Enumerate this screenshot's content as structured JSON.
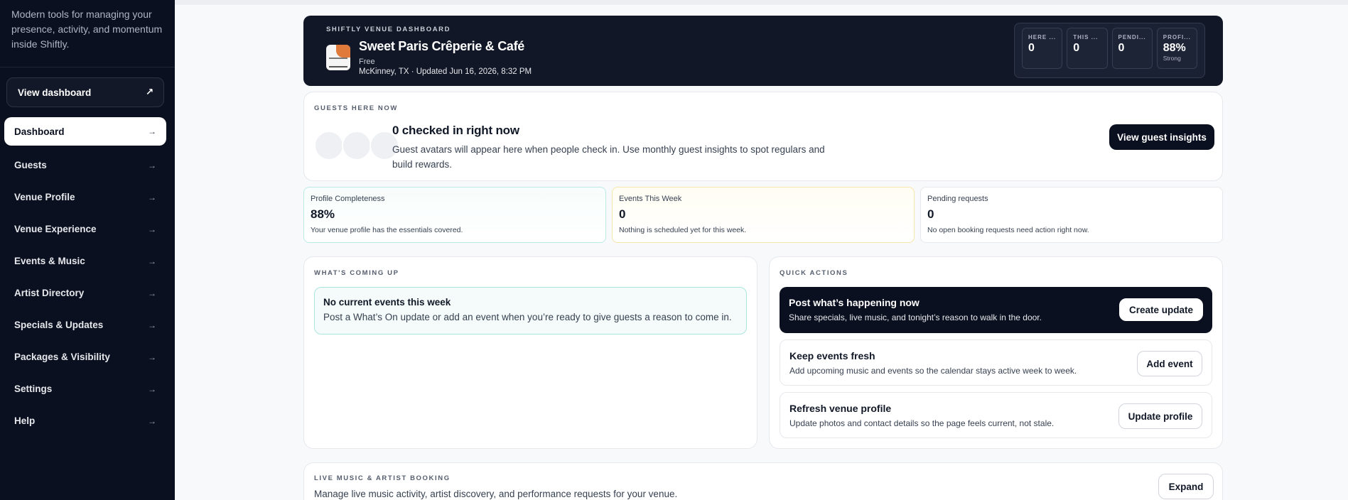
{
  "sidebar": {
    "tagline": "Modern tools for managing your presence, activity, and momentum inside Shiftly.",
    "view_dashboard": "View dashboard",
    "view_dashboard_icon": "↗",
    "arrow": "→",
    "items": [
      {
        "label": "Dashboard"
      },
      {
        "label": "Guests"
      },
      {
        "label": "Venue Profile"
      },
      {
        "label": "Venue Experience"
      },
      {
        "label": "Events & Music"
      },
      {
        "label": "Artist Directory"
      },
      {
        "label": "Specials & Updates"
      },
      {
        "label": "Packages & Visibility"
      },
      {
        "label": "Settings"
      },
      {
        "label": "Help"
      }
    ]
  },
  "hero": {
    "eyebrow": "SHIFTLY VENUE DASHBOARD",
    "venue_name": "Sweet Paris Crêperie & Café",
    "tier": "Free",
    "meta": "McKinney, TX · Updated Jun 16, 2026, 8:32 PM",
    "stats": [
      {
        "label": "HERE ...",
        "value": "0",
        "sub": ""
      },
      {
        "label": "THIS ...",
        "value": "0",
        "sub": ""
      },
      {
        "label": "PENDI...",
        "value": "0",
        "sub": ""
      },
      {
        "label": "PROFI...",
        "value": "88%",
        "sub": "Strong"
      }
    ]
  },
  "guests": {
    "eyebrow": "GUESTS HERE NOW",
    "title": "0 checked in right now",
    "description": "Guest avatars will appear here when people check in. Use monthly guest insights to spot regulars and build rewards.",
    "button": "View guest insights"
  },
  "metrics": [
    {
      "label": "Profile Completeness",
      "value": "88%",
      "note": "Your venue profile has the essentials covered."
    },
    {
      "label": "Events This Week",
      "value": "0",
      "note": "Nothing is scheduled yet for this week."
    },
    {
      "label": "Pending requests",
      "value": "0",
      "note": "No open booking requests need action right now."
    }
  ],
  "upcoming": {
    "eyebrow": "WHAT'S COMING UP",
    "title": "No current events this week",
    "description": "Post a What’s On update or add an event when you’re ready to give guests a reason to come in."
  },
  "quick_actions": {
    "eyebrow": "QUICK ACTIONS",
    "items": [
      {
        "title": "Post what’s happening now",
        "description": "Share specials, live music, and tonight’s reason to walk in the door.",
        "button": "Create update"
      },
      {
        "title": "Keep events fresh",
        "description": "Add upcoming music and events so the calendar stays active week to week.",
        "button": "Add event"
      },
      {
        "title": "Refresh venue profile",
        "description": "Update photos and contact details so the page feels current, not stale.",
        "button": "Update profile"
      }
    ]
  },
  "live_music": {
    "eyebrow": "LIVE MUSIC & ARTIST BOOKING",
    "description": "Manage live music activity, artist discovery, and performance requests for your venue.",
    "button": "Expand"
  }
}
